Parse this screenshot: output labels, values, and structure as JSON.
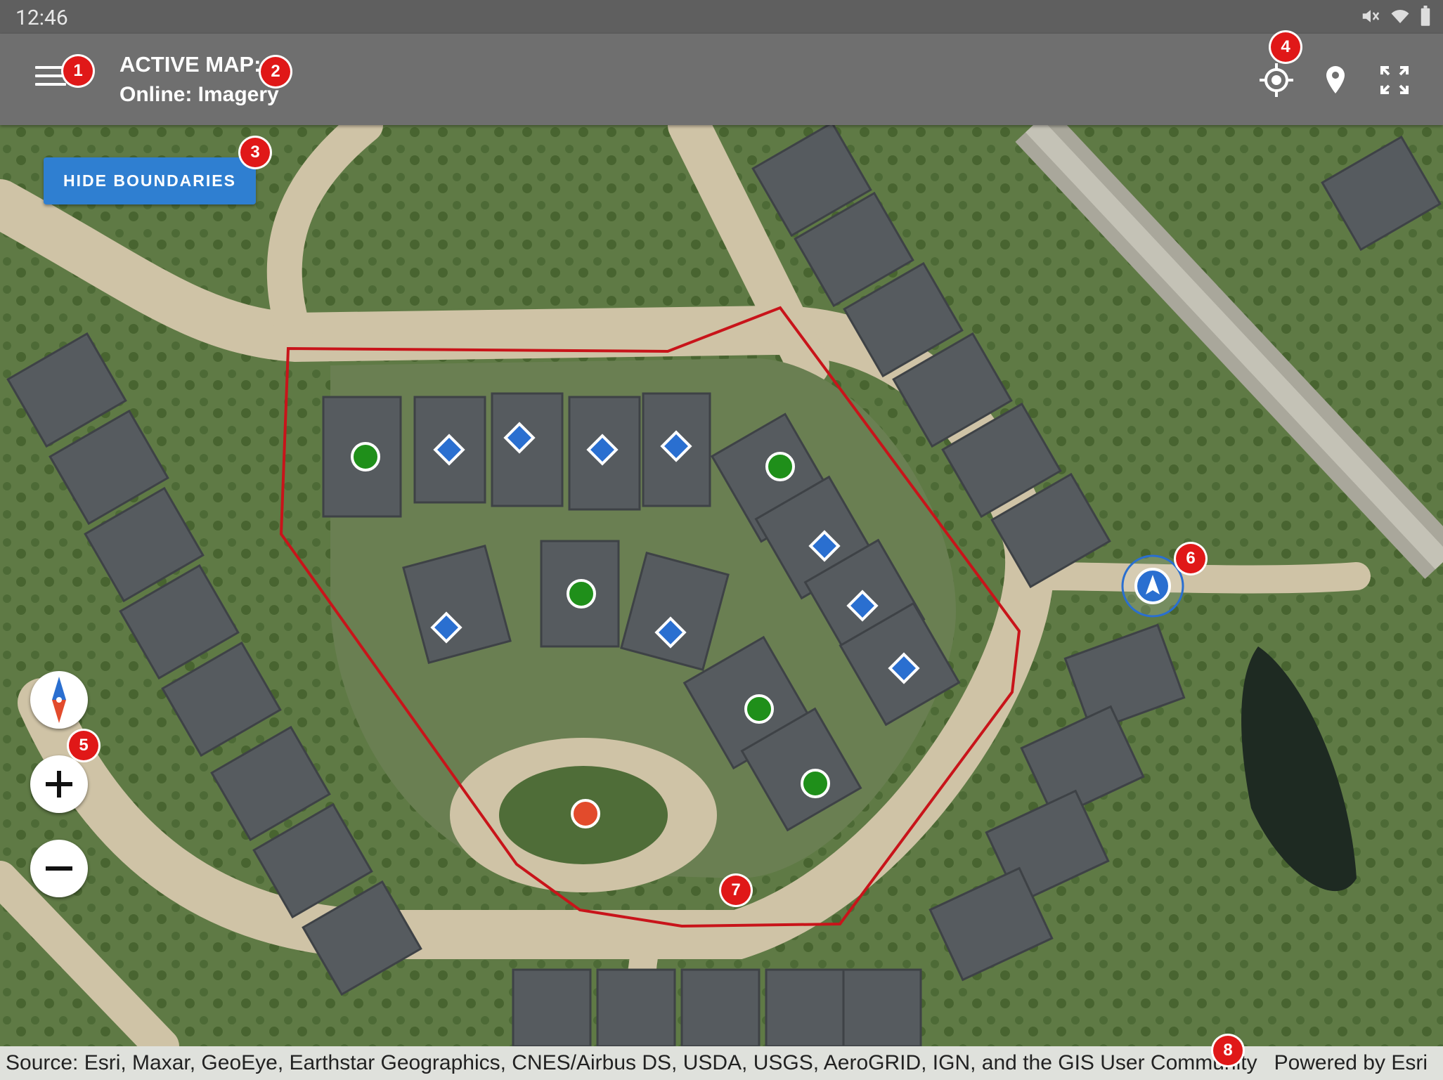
{
  "status_bar": {
    "time": "12:46"
  },
  "app_bar": {
    "title": "ACTIVE MAP:",
    "subtitle": "Online: Imagery"
  },
  "map": {
    "hide_boundaries_label": "HIDE BOUNDARIES"
  },
  "footer": {
    "attribution": "Source: Esri, Maxar, GeoEye, Earthstar Geographics, CNES/Airbus DS, USDA, USGS, AeroGRID, IGN, and the GIS User Community",
    "powered_by": "Powered by Esri"
  },
  "callouts": [
    "1",
    "2",
    "3",
    "4",
    "5",
    "6",
    "7",
    "8"
  ],
  "colors": {
    "appbar": "#6f6f6f",
    "button_blue": "#2f7fd1",
    "boundary_red": "#c8141a",
    "marker_green": "#1f8f1a",
    "marker_blue": "#2a6fd0",
    "marker_red": "#e24b2c",
    "callout_red": "#e01818"
  },
  "icons": [
    "menu-icon",
    "gps-target-icon",
    "location-pin-icon",
    "fullscreen-icon",
    "compass-icon",
    "zoom-in-icon",
    "zoom-out-icon",
    "navigation-arrow-icon",
    "mute-icon",
    "wifi-icon",
    "battery-icon"
  ]
}
